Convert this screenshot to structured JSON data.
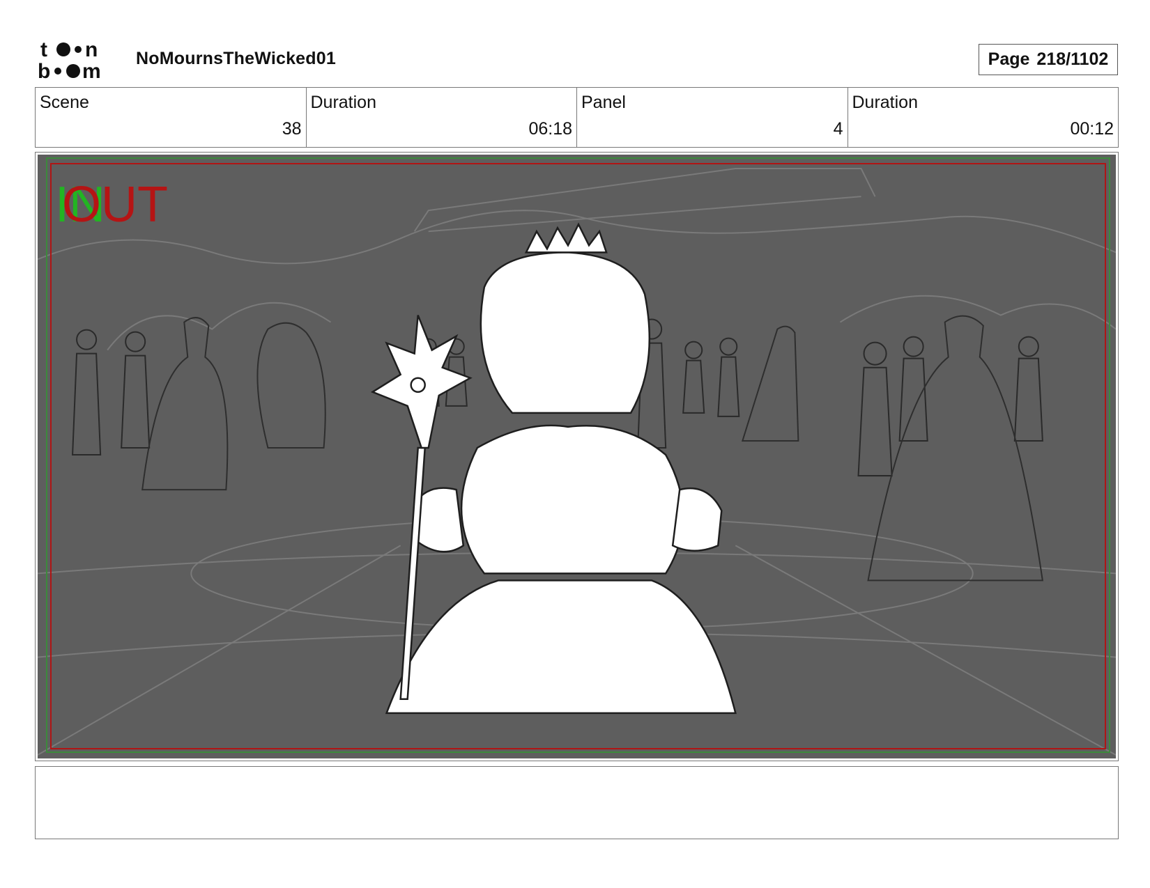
{
  "header": {
    "logo_text": "toon boom",
    "project_title": "NoMournsTheWicked01",
    "page_label": "Page",
    "page_number": "218/1102"
  },
  "info": {
    "scene_label": "Scene",
    "scene_value": "38",
    "scene_duration_label": "Duration",
    "scene_duration_value": "06:18",
    "panel_label": "Panel",
    "panel_value": "4",
    "panel_duration_label": "Duration",
    "panel_duration_value": "00:12"
  },
  "panel": {
    "in_marker": "IN",
    "out_marker": "OUT",
    "colors": {
      "background": "#5e5e5e",
      "safe_area_green": "#3c8a3c",
      "safe_area_red": "#b01515",
      "in_marker": "#22b522",
      "out_marker": "#b51414"
    }
  },
  "notes": {
    "text": ""
  }
}
